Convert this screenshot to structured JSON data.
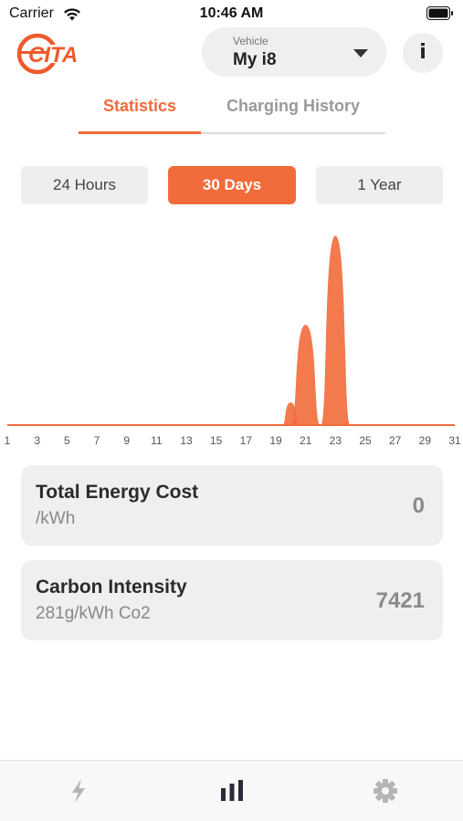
{
  "status_bar": {
    "carrier": "Carrier",
    "time": "10:46 AM"
  },
  "header": {
    "logo_text": "CITA",
    "vehicle_caption": "Vehicle",
    "vehicle_value": "My i8",
    "info_label": "i"
  },
  "tabs": [
    {
      "label": "Statistics",
      "active": true
    },
    {
      "label": "Charging History",
      "active": false
    }
  ],
  "range_buttons": [
    {
      "label": "24 Hours",
      "active": false
    },
    {
      "label": "30 Days",
      "active": true
    },
    {
      "label": "1 Year",
      "active": false
    }
  ],
  "chart_data": {
    "type": "area",
    "x_ticks": [
      "1",
      "3",
      "5",
      "7",
      "9",
      "11",
      "13",
      "15",
      "17",
      "19",
      "21",
      "23",
      "25",
      "27",
      "29",
      "31"
    ],
    "xlim": [
      1,
      31
    ],
    "x": [
      1,
      2,
      3,
      4,
      5,
      6,
      7,
      8,
      9,
      10,
      11,
      12,
      13,
      14,
      15,
      16,
      17,
      18,
      19,
      20,
      21,
      22,
      23,
      24,
      25,
      26,
      27,
      28,
      29,
      30,
      31
    ],
    "values": [
      0,
      0,
      0,
      0,
      0,
      0,
      0,
      0,
      0,
      0,
      0,
      0,
      0,
      0,
      0,
      0,
      0,
      0,
      0,
      12,
      53,
      0,
      100,
      0,
      0,
      0,
      0,
      0,
      0,
      0,
      0
    ],
    "ylim": [
      0,
      105
    ],
    "color": "#f26b3a",
    "grid": false
  },
  "cards": {
    "energy": {
      "title": "Total Energy Cost",
      "subtitle": "/kWh",
      "value": "0"
    },
    "carbon": {
      "title": "Carbon Intensity",
      "subtitle": "281g/kWh Co2",
      "value": "7421"
    }
  },
  "tab_bar": {
    "items": [
      {
        "icon": "lightning-icon",
        "active": false
      },
      {
        "icon": "bar-chart-icon",
        "active": true
      },
      {
        "icon": "gear-icon",
        "active": false
      }
    ]
  },
  "colors": {
    "accent": "#f26b3a",
    "logo": "#ee5a2c",
    "inactive_icon": "#b5b5b5",
    "active_icon": "#2b2b3b"
  }
}
